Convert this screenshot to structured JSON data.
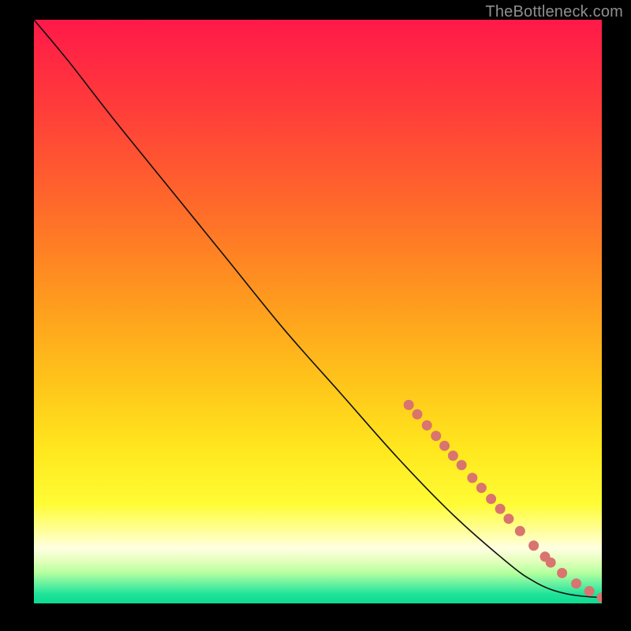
{
  "attribution": "TheBottleneck.com",
  "chart_data": {
    "type": "line",
    "title": "",
    "xlabel": "",
    "ylabel": "",
    "xlim": [
      0,
      100
    ],
    "ylim": [
      0,
      100
    ],
    "curve": [
      {
        "x": 0,
        "y": 100
      },
      {
        "x": 6,
        "y": 93
      },
      {
        "x": 14,
        "y": 83
      },
      {
        "x": 24,
        "y": 71
      },
      {
        "x": 34,
        "y": 59
      },
      {
        "x": 44,
        "y": 47
      },
      {
        "x": 54,
        "y": 36
      },
      {
        "x": 64,
        "y": 25
      },
      {
        "x": 74,
        "y": 15
      },
      {
        "x": 84,
        "y": 6.5
      },
      {
        "x": 88,
        "y": 3.8
      },
      {
        "x": 91,
        "y": 2.4
      },
      {
        "x": 94,
        "y": 1.6
      },
      {
        "x": 97,
        "y": 1.2
      },
      {
        "x": 100,
        "y": 1.0
      }
    ],
    "bottleneck_markers": [
      {
        "x": 66,
        "y": 34.0
      },
      {
        "x": 67.5,
        "y": 32.4
      },
      {
        "x": 69.2,
        "y": 30.5
      },
      {
        "x": 70.8,
        "y": 28.7
      },
      {
        "x": 72.3,
        "y": 27.0
      },
      {
        "x": 73.8,
        "y": 25.3
      },
      {
        "x": 75.3,
        "y": 23.7
      },
      {
        "x": 77.2,
        "y": 21.5
      },
      {
        "x": 78.8,
        "y": 19.8
      },
      {
        "x": 80.5,
        "y": 17.9
      },
      {
        "x": 82.1,
        "y": 16.2
      },
      {
        "x": 83.6,
        "y": 14.5
      },
      {
        "x": 85.6,
        "y": 12.4
      },
      {
        "x": 88.0,
        "y": 9.9
      },
      {
        "x": 90.0,
        "y": 8.0
      },
      {
        "x": 91.0,
        "y": 7.0
      },
      {
        "x": 93.0,
        "y": 5.2
      },
      {
        "x": 95.5,
        "y": 3.4
      },
      {
        "x": 97.8,
        "y": 2.1
      },
      {
        "x": 100,
        "y": 1.0
      }
    ],
    "gradient_stops": [
      {
        "offset": 0.0,
        "color": "#ff1949"
      },
      {
        "offset": 0.15,
        "color": "#ff3c3a"
      },
      {
        "offset": 0.32,
        "color": "#ff6a2a"
      },
      {
        "offset": 0.48,
        "color": "#ff9a1e"
      },
      {
        "offset": 0.62,
        "color": "#ffc41a"
      },
      {
        "offset": 0.74,
        "color": "#ffe81e"
      },
      {
        "offset": 0.83,
        "color": "#fffc35"
      },
      {
        "offset": 0.885,
        "color": "#ffffb0"
      },
      {
        "offset": 0.905,
        "color": "#ffffe2"
      },
      {
        "offset": 0.928,
        "color": "#e2ffba"
      },
      {
        "offset": 0.948,
        "color": "#b4ff9e"
      },
      {
        "offset": 0.968,
        "color": "#62f0a0"
      },
      {
        "offset": 0.985,
        "color": "#1de39a"
      },
      {
        "offset": 1.0,
        "color": "#0fd990"
      }
    ],
    "marker_color": "#d9746f",
    "curve_color": "#111111"
  }
}
